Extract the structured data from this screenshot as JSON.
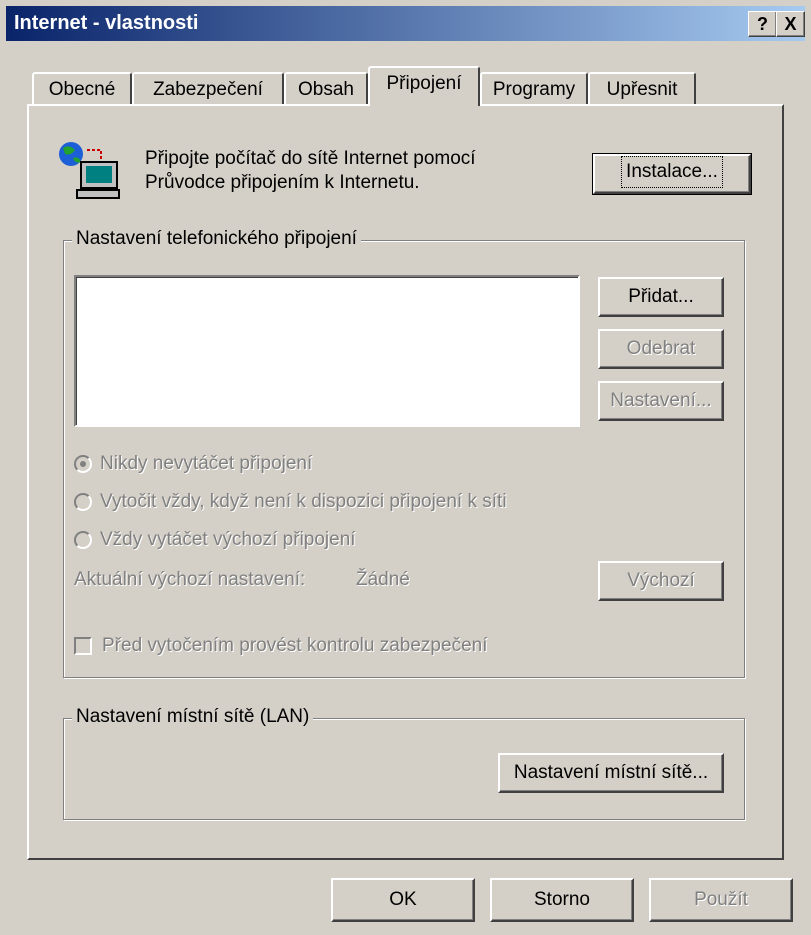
{
  "window": {
    "title": "Internet - vlastnosti",
    "help_label": "?",
    "close_label": "X"
  },
  "tabs": [
    {
      "label": "Obecné"
    },
    {
      "label": "Zabezpečení"
    },
    {
      "label": "Obsah"
    },
    {
      "label": "Připojení"
    },
    {
      "label": "Programy"
    },
    {
      "label": "Upřesnit"
    }
  ],
  "active_tab": "Připojení",
  "wizard": {
    "line1": "Připojte počítač do sítě Internet pomocí",
    "line2": "Průvodce připojením k Internetu.",
    "install_label": "Instalace...",
    "icon": "network-computer-icon"
  },
  "dialup": {
    "group_label": "Nastavení telefonického připojení",
    "add_label": "Přidat...",
    "remove_label": "Odebrat",
    "settings_label": "Nastavení...",
    "radio_never": "Nikdy nevytáčet připojení",
    "radio_when_none": "Vytočit vždy, když není k dispozici připojení k síti",
    "radio_always": "Vždy vytáčet výchozí připojení",
    "selected_radio": "Nikdy nevytáčet připojení",
    "current_default_label": "Aktuální výchozí nastavení:",
    "current_default_value": "Žádné",
    "default_button": "Výchozí",
    "security_check_label": "Před vytočením provést kontrolu zabezpečení",
    "security_check_checked": false
  },
  "lan": {
    "group_label": "Nastavení místní sítě (LAN)",
    "settings_button": "Nastavení místní sítě..."
  },
  "footer": {
    "ok_label": "OK",
    "cancel_label": "Storno",
    "apply_label": "Použít"
  },
  "colors": {
    "titlebar_start": "#0a246a",
    "titlebar_end": "#a6caf0",
    "face": "#d4d0c8",
    "disabled_text": "#808080"
  }
}
